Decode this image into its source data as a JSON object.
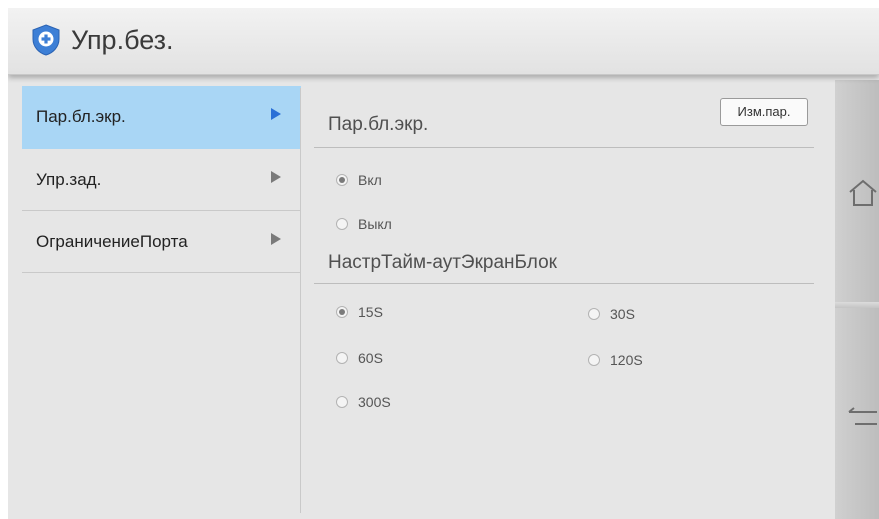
{
  "header": {
    "title": "Упр.без.",
    "icon": "shield-plus-icon",
    "accent": "#3d7fd6"
  },
  "sidebar": {
    "items": [
      {
        "label": "Пар.бл.экр.",
        "active": true
      },
      {
        "label": "Упр.зад.",
        "active": false
      },
      {
        "label": "ОграничениеПорта",
        "active": false
      }
    ]
  },
  "main": {
    "edit_button": "Изм.пар.",
    "screen_lock": {
      "title": "Пар.бл.экр.",
      "options": [
        {
          "label": "Вкл",
          "checked": true
        },
        {
          "label": "Выкл",
          "checked": false
        }
      ]
    },
    "timeout": {
      "title": "НастрТайм-аутЭкранБлок",
      "options": [
        {
          "label": "15S",
          "checked": true
        },
        {
          "label": "30S",
          "checked": false
        },
        {
          "label": "60S",
          "checked": false
        },
        {
          "label": "120S",
          "checked": false
        },
        {
          "label": "300S",
          "checked": false
        }
      ]
    }
  },
  "right_rail": {
    "icons": [
      "home-icon",
      "back-icon"
    ]
  },
  "colors": {
    "active_item_bg": "#a9d6f5",
    "active_arrow": "#2a6fd6",
    "panel_bg": "#e6e6e6"
  }
}
